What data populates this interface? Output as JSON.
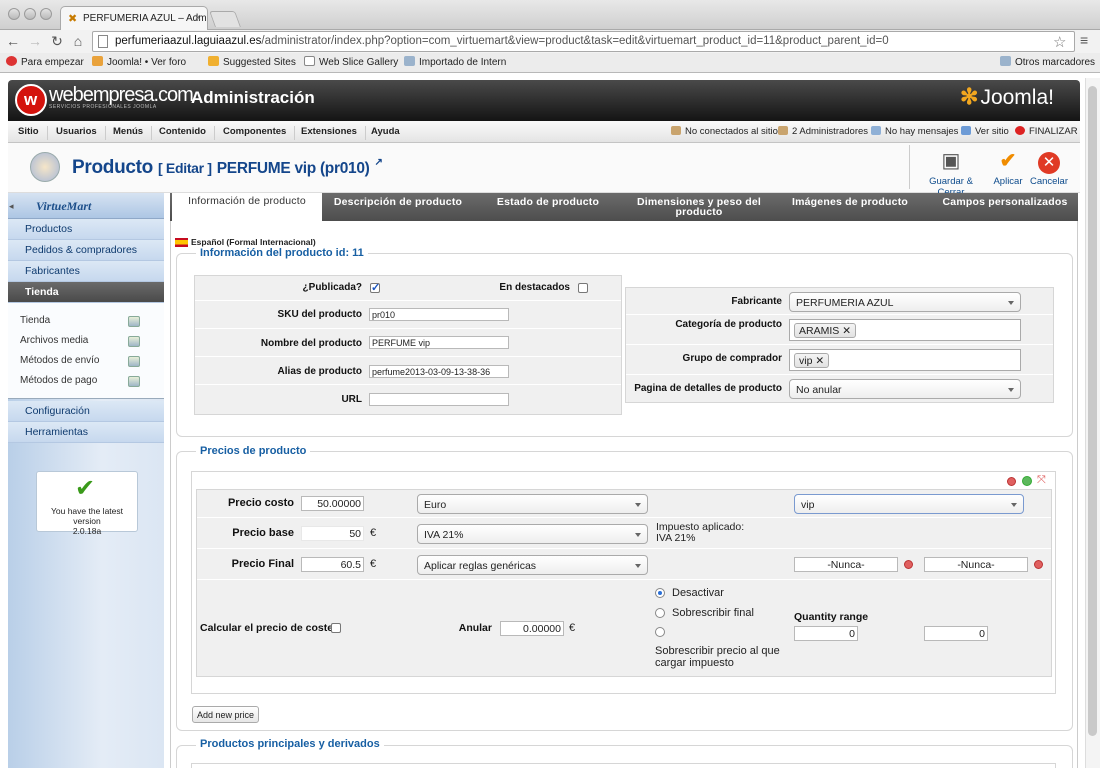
{
  "browser": {
    "tab_title": "PERFUMERIA AZUL – Admi",
    "url_host": "perfumeriaazul.laguiaazul.es",
    "url_path": "/administrator/index.php?option=com_virtuemart&view=product&task=edit&virtuemart_product_id=11&product_parent_id=0",
    "bookmarks": [
      "Para empezar",
      "Joomla! • Ver foro",
      "Suggested Sites",
      "Web Slice Gallery",
      "Importado de Intern"
    ],
    "other_bookmarks": "Otros marcadores"
  },
  "header": {
    "brand": "webempresa.com",
    "brand_sub": "SERVICIOS PROFESIONALES JOOMLA",
    "title": "Administración",
    "joomla": "Joomla!"
  },
  "menu": {
    "items": [
      "Sitio",
      "Usuarios",
      "Menús",
      "Contenido",
      "Componentes",
      "Extensiones",
      "Ayuda"
    ],
    "status": [
      "No conectados al sitio",
      "2 Administradores",
      "No hay mensajes",
      "Ver sitio",
      "FINALIZAR"
    ]
  },
  "titlebar": {
    "title": "Producto",
    "edit": "[ Editar ]",
    "product": "PERFUME vip (pr010)",
    "buttons": [
      "Guardar & Cerrar",
      "Aplicar",
      "Cancelar"
    ]
  },
  "sidebar": {
    "logo": "VirtueMart",
    "links": [
      "Productos",
      "Pedidos & compradores",
      "Fabricantes",
      "Tienda"
    ],
    "sub": [
      "Tienda",
      "Archivos media",
      "Métodos de envío",
      "Métodos de pago"
    ],
    "links2": [
      "Configuración",
      "Herramientas"
    ],
    "version_text": "You have the latest version",
    "version": "2.0.18a"
  },
  "tabs": [
    "Información de producto",
    "Descripción de producto",
    "Estado de producto",
    "Dimensiones y peso del producto",
    "Imágenes de producto",
    "Campos personalizados"
  ],
  "info": {
    "language": "Español (Formal Internacional)",
    "legend": "Información del producto id: 11",
    "published_label": "¿Publicada?",
    "featured_label": "En destacados",
    "sku_label": "SKU del producto",
    "sku": "pr010",
    "name_label": "Nombre del producto",
    "name": "PERFUME vip",
    "alias_label": "Alias de producto",
    "alias": "perfume2013-03-09-13-38-36",
    "url_label": "URL",
    "url": "",
    "manufacturer_label": "Fabricante",
    "manufacturer": "PERFUMERIA AZUL",
    "category_label": "Categoría de producto",
    "category": "ARAMIS",
    "group_label": "Grupo de comprador",
    "group": "vip",
    "details_label": "Pagina de detalles de producto",
    "details": "No anular"
  },
  "prices": {
    "legend": "Precios de producto",
    "cost_label": "Precio costo",
    "cost": "50.00000",
    "currency": "Euro",
    "shopper_group": "vip",
    "base_label": "Precio base",
    "base": "50",
    "euro": "€",
    "tax": "IVA 21%",
    "tax_applied_label": "Impuesto aplicado:",
    "tax_applied": "IVA 21%",
    "final_label": "Precio Final",
    "final": "60.5",
    "rules": "Aplicar reglas genéricas",
    "never1": "-Nunca-",
    "never2": "-Nunca-",
    "calc_label": "Calcular el precio de coste",
    "override_label": "Anular",
    "override": "0.00000",
    "radio1": "Desactivar",
    "radio2": "Sobrescribir final",
    "radio3": "Sobrescribir precio al que cargar impuesto",
    "qty_label": "Quantity range",
    "qty_from": "0",
    "qty_to": "0",
    "add_btn": "Add new price"
  },
  "related_legend": "Productos principales y derivados"
}
